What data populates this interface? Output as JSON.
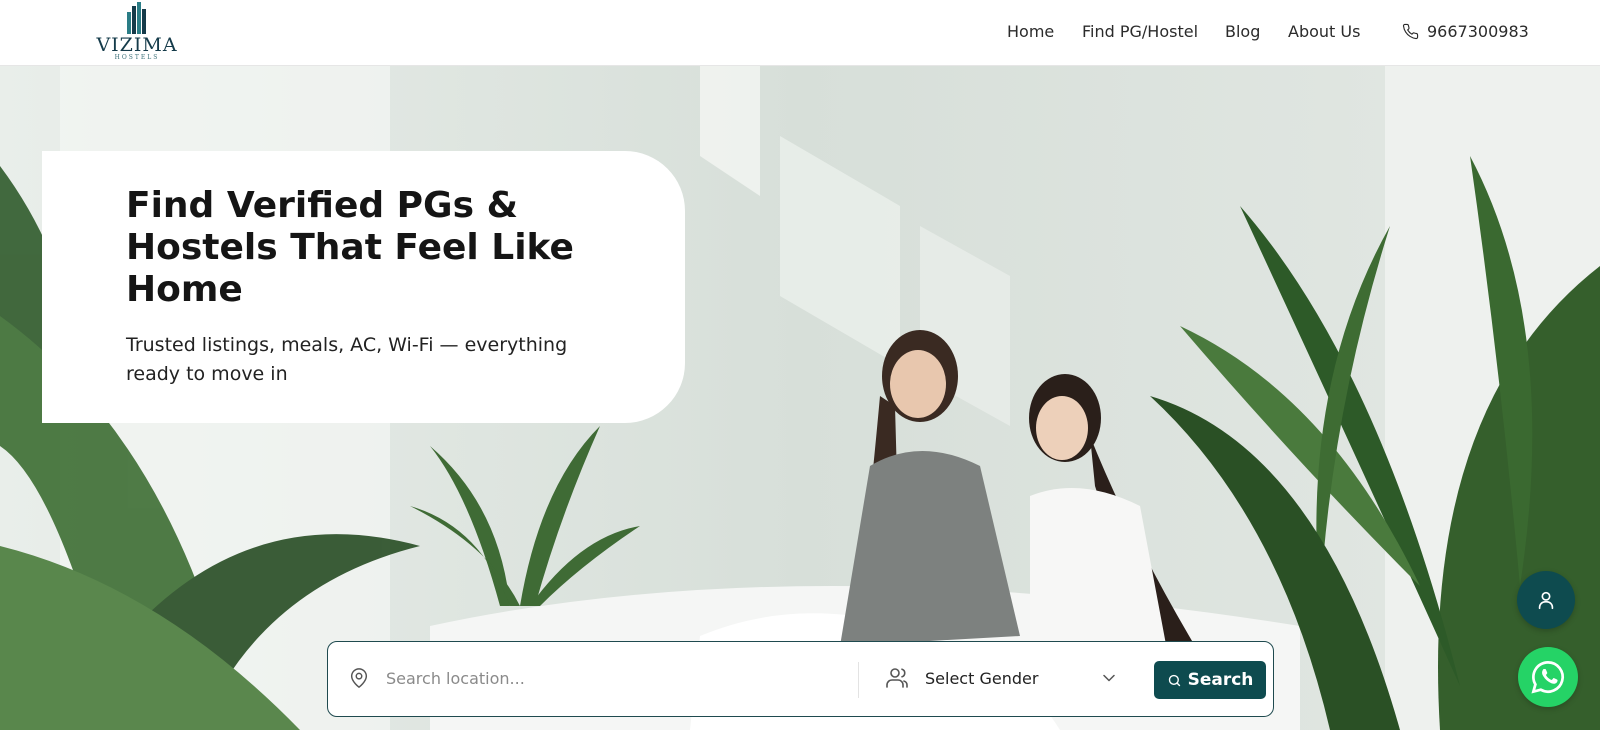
{
  "brand": {
    "name": "VIZIMA",
    "tagline": "HOSTELS"
  },
  "nav": {
    "items": [
      "Home",
      "Find PG/Hostel",
      "Blog",
      "About Us"
    ],
    "phone": "9667300983"
  },
  "hero": {
    "title": "Find Verified PGs & Hostels That Feel Like Home",
    "subtitle": "Trusted listings, meals, AC, Wi-Fi — everything ready to move in"
  },
  "search": {
    "location_placeholder": "Search location...",
    "gender_label": "Select Gender",
    "button_label": "Search"
  },
  "icons": {
    "phone": "phone-icon",
    "location": "map-pin-icon",
    "gender": "users-icon",
    "dropdown": "chevron-down-icon",
    "search": "search-icon",
    "user_fab": "user-icon",
    "whatsapp": "whatsapp-icon"
  },
  "colors": {
    "primary": "#0e4b4f",
    "brand_text": "#153b4a",
    "whatsapp": "#25d366"
  }
}
